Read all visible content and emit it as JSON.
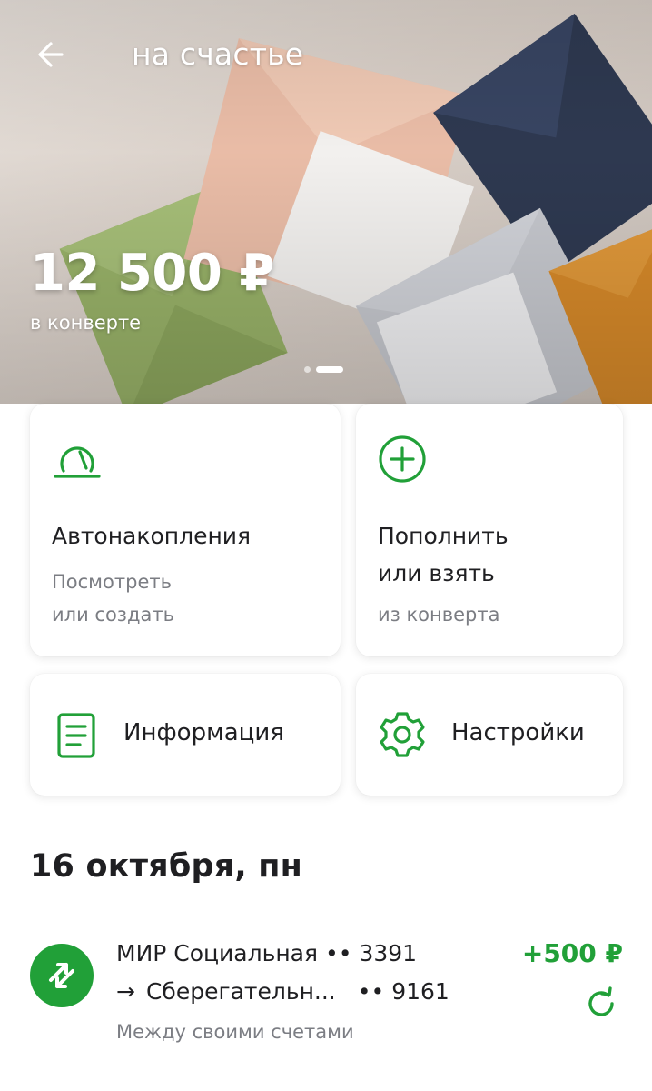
{
  "header": {
    "title": "на счастье",
    "balance": "12 500 ₽",
    "balance_caption": "в конверте",
    "pager": {
      "count": 2,
      "active_index": 1
    }
  },
  "actions": {
    "autosave": {
      "title": "Автонакопления",
      "sub_line1": "Посмотреть",
      "sub_line2": "или создать",
      "icon": "gauge-icon"
    },
    "topup": {
      "title_line1": "Пополнить",
      "title_line2": "или взять",
      "sub": "из конверта",
      "icon": "plus-circle-icon"
    },
    "info": {
      "label": "Информация",
      "icon": "document-icon"
    },
    "settings": {
      "label": "Настройки",
      "icon": "gear-icon"
    }
  },
  "history": {
    "date": "16 октября, пн",
    "transactions": [
      {
        "from_name": "МИР Социальная",
        "from_mask": "•• 3391",
        "arrow": "→",
        "to_name": "Сберегательн...",
        "to_mask": "•• 9161",
        "description": "Между своими счетами",
        "amount": "+500 ₽",
        "icon": "transfer-arrows-icon",
        "repeat_icon": "repeat-icon"
      }
    ]
  },
  "colors": {
    "accent": "#21a038",
    "text_primary": "#1f1f22",
    "text_secondary": "#7b7d83",
    "card_bg": "#ffffff"
  }
}
